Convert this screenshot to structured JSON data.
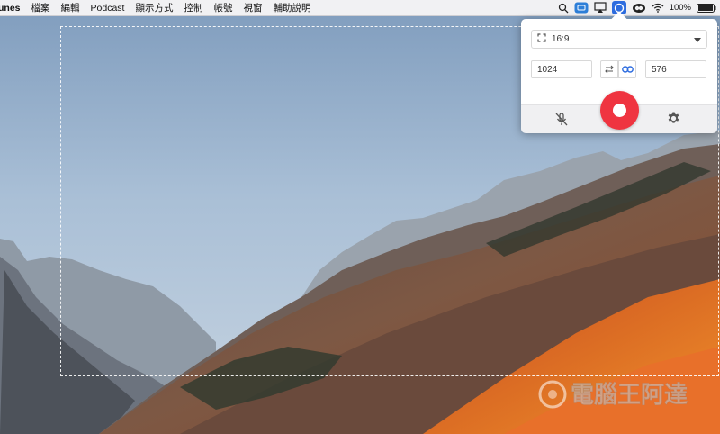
{
  "menubar": {
    "app": "unes",
    "items": [
      "檔案",
      "編輯",
      "Podcast",
      "顯示方式",
      "控制",
      "帳號",
      "視窗",
      "輔助說明"
    ],
    "battery": "100%"
  },
  "recorder": {
    "aspect_ratio": "16:9",
    "width_value": "1024",
    "height_value": "576",
    "accent": "#ef3440"
  },
  "watermark": {
    "logo": "電腦王阿達"
  }
}
